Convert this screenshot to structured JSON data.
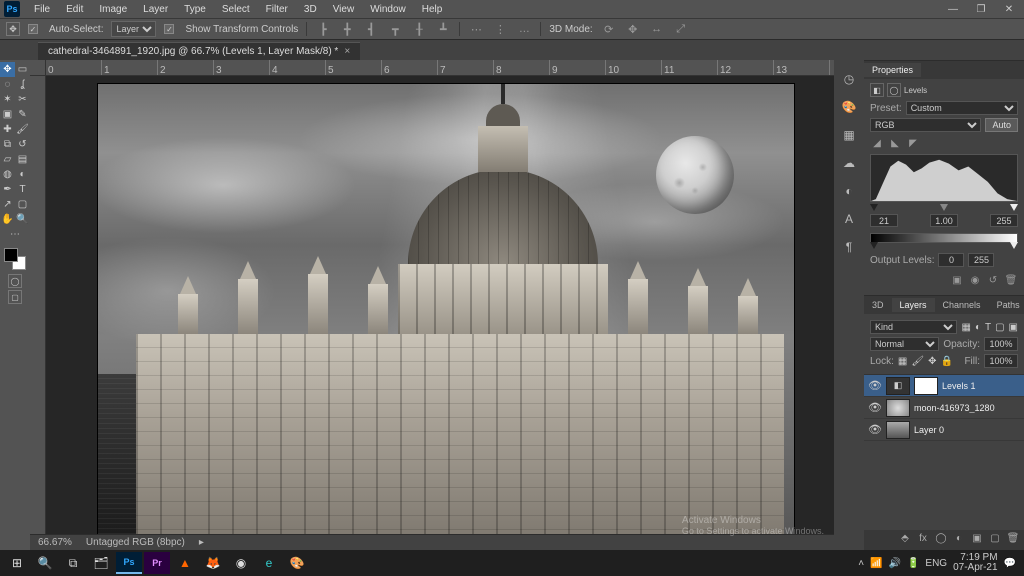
{
  "menu": {
    "items": [
      "File",
      "Edit",
      "Image",
      "Layer",
      "Type",
      "Select",
      "Filter",
      "3D",
      "View",
      "Window",
      "Help"
    ]
  },
  "optionsbar": {
    "auto_select_label": "Auto-Select:",
    "auto_select_target": "Layer",
    "show_transform_label": "Show Transform Controls",
    "mode3d_label": "3D Mode:"
  },
  "document": {
    "tab_title": "cathedral-3464891_1920.jpg @ 66.7% (Levels 1, Layer Mask/8) *",
    "zoom": "66.67%",
    "info": "Untagged RGB (8bpc)"
  },
  "properties": {
    "panel_title": "Properties",
    "adjustment_type": "Levels",
    "preset_label": "Preset:",
    "preset_value": "Custom",
    "channel_value": "RGB",
    "auto_label": "Auto",
    "input_black": "21",
    "input_gamma": "1.00",
    "input_white": "255",
    "output_label": "Output Levels:",
    "output_black": "0",
    "output_white": "255"
  },
  "layers": {
    "tabs": [
      "3D",
      "Layers",
      "Channels",
      "Paths"
    ],
    "kind_label": "Kind",
    "blend_mode": "Normal",
    "opacity_label": "Opacity:",
    "opacity_value": "100%",
    "lock_label": "Lock:",
    "fill_label": "Fill:",
    "fill_value": "100%",
    "items": [
      {
        "name": "Levels 1",
        "type": "adjustment"
      },
      {
        "name": "moon-416973_1280",
        "type": "smart"
      },
      {
        "name": "Layer 0",
        "type": "pixel"
      }
    ]
  },
  "watermark": {
    "title": "Activate Windows",
    "sub": "Go to Settings to activate Windows."
  },
  "taskbar": {
    "time": "7:19 PM",
    "date": "07-Apr-21"
  },
  "ruler_marks": [
    "0",
    "1",
    "2",
    "3",
    "4",
    "5",
    "6",
    "7",
    "8",
    "9",
    "10",
    "11",
    "12",
    "13"
  ]
}
